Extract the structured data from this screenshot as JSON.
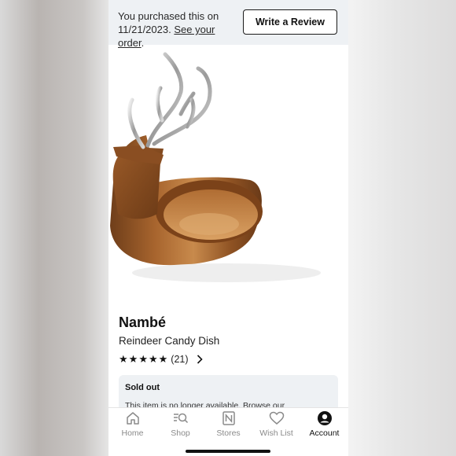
{
  "purchase": {
    "message": "You purchased this on 11/21/2023.",
    "order_link": "See your order",
    "link_suffix": ".",
    "review_button": "Write a Review"
  },
  "product": {
    "brand": "Nambé",
    "name": "Reindeer Candy Dish",
    "rating_count": "(21)",
    "stars": 5
  },
  "availability": {
    "title": "Sold out",
    "text": "This item is no longer available. Browse our"
  },
  "nav": {
    "items": [
      {
        "label": "Home",
        "icon": "home-icon"
      },
      {
        "label": "Shop",
        "icon": "shop-search-icon"
      },
      {
        "label": "Stores",
        "icon": "store-icon"
      },
      {
        "label": "Wish List",
        "icon": "heart-icon"
      },
      {
        "label": "Account",
        "icon": "account-icon"
      }
    ],
    "active": "Account"
  },
  "colors": {
    "banner_bg": "#eef1f4",
    "text_dark": "#111111",
    "nav_inactive": "#8a8a8a"
  }
}
